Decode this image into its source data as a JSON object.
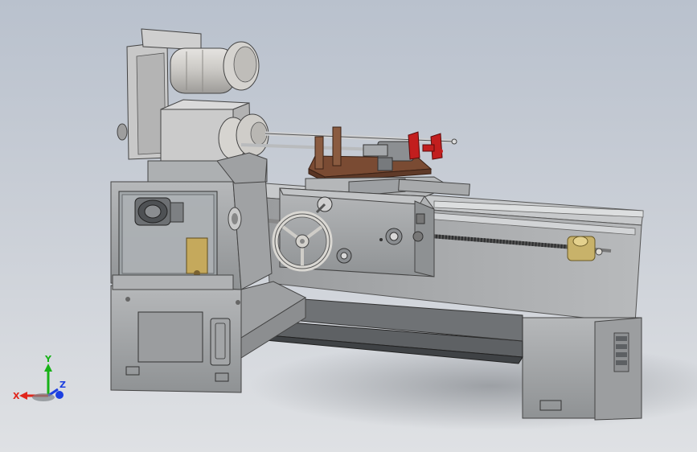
{
  "viewport": {
    "model_name": "lathe-assembly"
  },
  "triad": {
    "x_label": "X",
    "y_label": "Y",
    "z_label": "Z",
    "colors": {
      "x": "#e0261c",
      "y": "#17b217",
      "z": "#1c3fe0"
    }
  },
  "colors": {
    "background_top": "#b9c1cd",
    "background_bottom": "#dfe1e4",
    "machine_body": "#a7a9ab",
    "machine_dark": "#7b7e81",
    "carriage_plate": "#7a4b33",
    "handwheel": "#d9d7d2",
    "brass_accent": "#c8b26a",
    "red_parts": "#c21e1e"
  }
}
